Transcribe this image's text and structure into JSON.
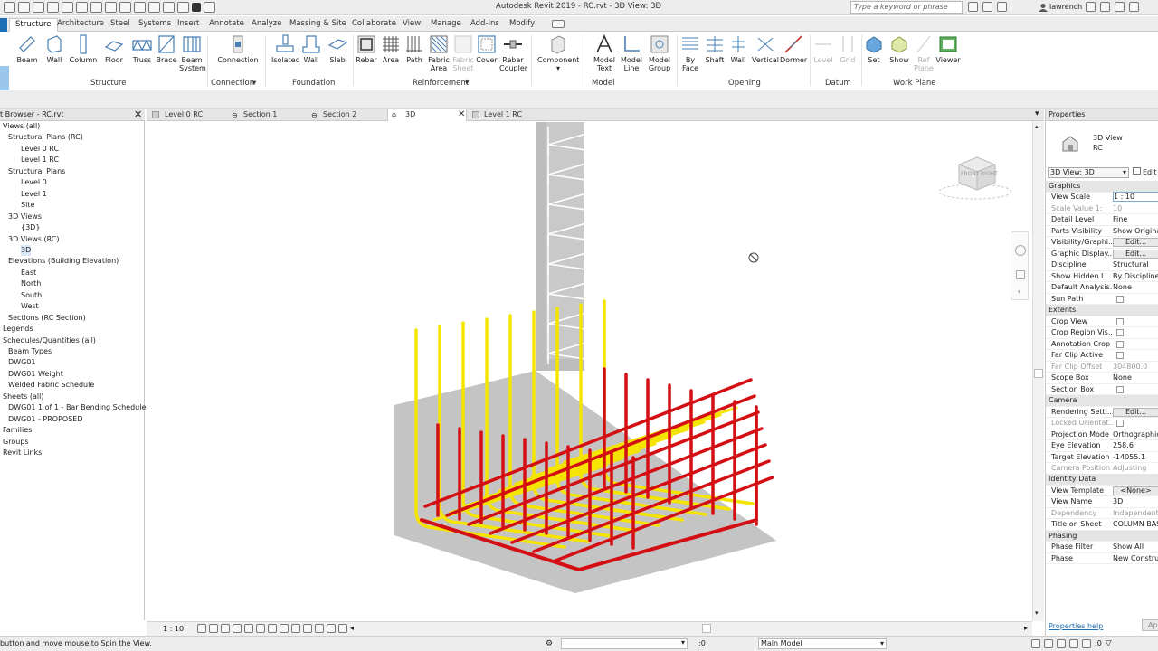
{
  "window": {
    "title": "Autodesk Revit 2019 - RC.rvt - 3D View: 3D",
    "search_placeholder": "Type a keyword or phrase",
    "user": "lawrench"
  },
  "ribbon_tabs": [
    "Structure",
    "Architecture",
    "Steel",
    "Systems",
    "Insert",
    "Annotate",
    "Analyze",
    "Massing & Site",
    "Collaborate",
    "View",
    "Manage",
    "Add-Ins",
    "Modify"
  ],
  "ribbon": {
    "modify_fragment": "ify",
    "structure_panel": {
      "label": "Structure",
      "buttons": [
        "Beam",
        "Wall",
        "Column",
        "Floor",
        "Truss",
        "Brace",
        "Beam System"
      ]
    },
    "connection_panel": {
      "label": "Connection",
      "buttons": [
        "Connection"
      ]
    },
    "foundation_panel": {
      "label": "Foundation",
      "buttons": [
        "Isolated",
        "Wall",
        "Slab"
      ]
    },
    "reinforcement_panel": {
      "label": "Reinforcement",
      "buttons": [
        "Rebar",
        "Area",
        "Path",
        "Fabric Area",
        "Fabric Sheet",
        "Cover",
        "Rebar Coupler"
      ]
    },
    "component_btn": "Component",
    "model_panel": {
      "label": "Model",
      "buttons": [
        "Model Text",
        "Model Line",
        "Model Group"
      ]
    },
    "opening_panel": {
      "label": "Opening",
      "buttons": [
        "By Face",
        "Shaft",
        "Wall",
        "Vertical",
        "Dormer"
      ]
    },
    "datum_panel": {
      "label": "Datum",
      "buttons": [
        "Level",
        "Grid"
      ]
    },
    "workplane_panel": {
      "label": "Work Plane",
      "buttons": [
        "Set",
        "Show",
        "Ref Plane",
        "Viewer"
      ]
    }
  },
  "project_browser": {
    "title": "t Browser - RC.rvt",
    "items": [
      {
        "label": "Views (all)",
        "indent": 0
      },
      {
        "label": "Structural Plans (RC)",
        "indent": 1
      },
      {
        "label": "Level 0 RC",
        "indent": 2
      },
      {
        "label": "Level 1 RC",
        "indent": 2
      },
      {
        "label": "Structural Plans",
        "indent": 1
      },
      {
        "label": "Level 0",
        "indent": 2
      },
      {
        "label": "Level 1",
        "indent": 2
      },
      {
        "label": "Site",
        "indent": 2
      },
      {
        "label": "3D Views",
        "indent": 1
      },
      {
        "label": "{3D}",
        "indent": 2
      },
      {
        "label": "3D Views (RC)",
        "indent": 1
      },
      {
        "label": "3D",
        "indent": 2,
        "selected": true
      },
      {
        "label": "Elevations (Building Elevation)",
        "indent": 1
      },
      {
        "label": "East",
        "indent": 2
      },
      {
        "label": "North",
        "indent": 2
      },
      {
        "label": "South",
        "indent": 2
      },
      {
        "label": "West",
        "indent": 2
      },
      {
        "label": "Sections (RC Section)",
        "indent": 1
      },
      {
        "label": "Legends",
        "indent": 0
      },
      {
        "label": "Schedules/Quantities (all)",
        "indent": 0
      },
      {
        "label": "Beam Types",
        "indent": 1
      },
      {
        "label": "DWG01",
        "indent": 1
      },
      {
        "label": "DWG01 Weight",
        "indent": 1
      },
      {
        "label": "Welded Fabric Schedule",
        "indent": 1
      },
      {
        "label": "Sheets (all)",
        "indent": 0
      },
      {
        "label": "DWG01 1 of 1 - Bar Bending Schedule",
        "indent": 1
      },
      {
        "label": "DWG01 - PROPOSED",
        "indent": 1
      },
      {
        "label": "Families",
        "indent": 0
      },
      {
        "label": "Groups",
        "indent": 0
      },
      {
        "label": "Revit Links",
        "indent": 0
      }
    ]
  },
  "view_tabs": [
    "Level 0 RC",
    "Section 1",
    "Section 2",
    "3D",
    "Level 1 RC"
  ],
  "viewcube": {
    "front": "FRONT",
    "right": "RIGHT"
  },
  "view_control_bar": {
    "scale": "1 : 10"
  },
  "status": {
    "message": "button and move mouse to Spin the View.",
    "zero": ":0",
    "model": "Main Model",
    "filter_count": ":0"
  },
  "properties": {
    "header": "Properties",
    "type_name": "3D View",
    "type_sub": "RC",
    "selector": "3D View: 3D",
    "edit_type": "Edit",
    "help_link": "Properties help",
    "apply": "Ap",
    "rows": [
      {
        "group": "Graphics"
      },
      {
        "k": "View Scale",
        "v": "1 : 10",
        "input": true
      },
      {
        "k": "Scale Value    1:",
        "v": "10",
        "gray": true
      },
      {
        "k": "Detail Level",
        "v": "Fine"
      },
      {
        "k": "Parts Visibility",
        "v": "Show Original"
      },
      {
        "k": "Visibility/Graphi...",
        "v": "Edit...",
        "btn": true
      },
      {
        "k": "Graphic Display...",
        "v": "Edit...",
        "btn": true
      },
      {
        "k": "Discipline",
        "v": "Structural"
      },
      {
        "k": "Show Hidden Li...",
        "v": "By Discipline"
      },
      {
        "k": "Default Analysis...",
        "v": "None"
      },
      {
        "k": "Sun Path",
        "check": true
      },
      {
        "group": "Extents"
      },
      {
        "k": "Crop View",
        "check": true
      },
      {
        "k": "Crop Region Vis...",
        "check": true
      },
      {
        "k": "Annotation Crop",
        "check": true
      },
      {
        "k": "Far Clip Active",
        "check": true
      },
      {
        "k": "Far Clip Offset",
        "v": "304800.0",
        "gray": true
      },
      {
        "k": "Scope Box",
        "v": "None"
      },
      {
        "k": "Section Box",
        "check": true
      },
      {
        "group": "Camera"
      },
      {
        "k": "Rendering Setti...",
        "v": "Edit...",
        "btn": true
      },
      {
        "k": "Locked Orientat...",
        "check": true,
        "gray": true
      },
      {
        "k": "Projection Mode",
        "v": "Orthographic"
      },
      {
        "k": "Eye Elevation",
        "v": "258.6"
      },
      {
        "k": "Target Elevation",
        "v": "-14055.1"
      },
      {
        "k": "Camera Position",
        "v": "Adjusting",
        "gray": true
      },
      {
        "group": "Identity Data"
      },
      {
        "k": "View Template",
        "v": "<None>",
        "btn": true
      },
      {
        "k": "View Name",
        "v": "3D"
      },
      {
        "k": "Dependency",
        "v": "Independent",
        "gray": true
      },
      {
        "k": "Title on Sheet",
        "v": "COLUMN BASE"
      },
      {
        "group": "Phasing"
      },
      {
        "k": "Phase Filter",
        "v": "Show All"
      },
      {
        "k": "Phase",
        "v": "New Construction"
      }
    ]
  },
  "colors": {
    "accent": "#1f6fb5",
    "rebar_red": "#d40f14",
    "rebar_yellow": "#f5e400",
    "concrete": "#c6c6c6"
  }
}
